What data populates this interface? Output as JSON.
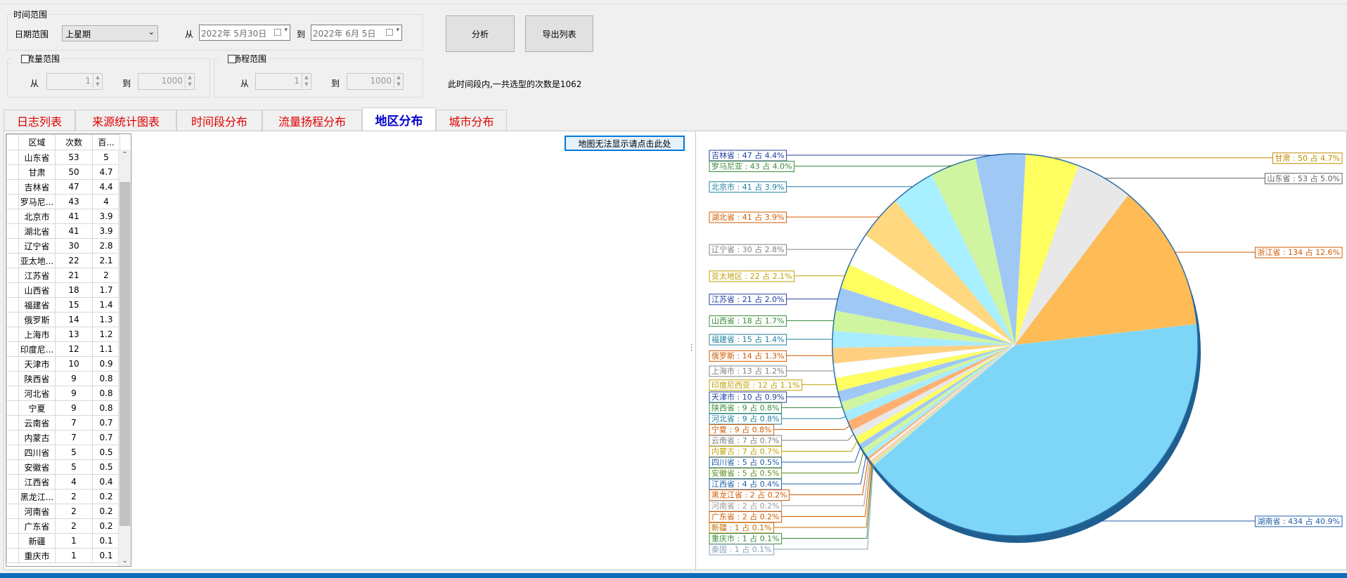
{
  "time_range": {
    "legend": "时间范围",
    "date_range_label": "日期范围",
    "date_range_value": "上星期",
    "from_label": "从",
    "to_label": "到",
    "from_date": "2022年  5月30日",
    "to_date": "2022年  6月  5日"
  },
  "buttons": {
    "analyze": "分析",
    "export": "导出列表",
    "map": "地图无法显示请点击此处"
  },
  "flow_range": {
    "legend": "流量范围",
    "from_label": "从",
    "to_label": "到",
    "from_value": "1",
    "to_value": "1000"
  },
  "head_range": {
    "legend": "扬程范围",
    "from_label": "从",
    "to_label": "到",
    "from_value": "1",
    "to_value": "1000"
  },
  "summary": "此时间段内,一共选型的次数是1062",
  "tabs": [
    {
      "label": "日志列表"
    },
    {
      "label": "来源统计图表"
    },
    {
      "label": "时间段分布"
    },
    {
      "label": "流量扬程分布"
    },
    {
      "label": "地区分布"
    },
    {
      "label": "城市分布"
    }
  ],
  "active_tab": 4,
  "grid": {
    "headers": [
      "区域",
      "次数",
      "百..."
    ],
    "rows": [
      [
        "山东省",
        "53",
        "5"
      ],
      [
        "甘肃",
        "50",
        "4.7"
      ],
      [
        "吉林省",
        "47",
        "4.4"
      ],
      [
        "罗马尼...",
        "43",
        "4"
      ],
      [
        "北京市",
        "41",
        "3.9"
      ],
      [
        "湖北省",
        "41",
        "3.9"
      ],
      [
        "辽宁省",
        "30",
        "2.8"
      ],
      [
        "亚太地...",
        "22",
        "2.1"
      ],
      [
        "江苏省",
        "21",
        "2"
      ],
      [
        "山西省",
        "18",
        "1.7"
      ],
      [
        "福建省",
        "15",
        "1.4"
      ],
      [
        "俄罗斯",
        "14",
        "1.3"
      ],
      [
        "上海市",
        "13",
        "1.2"
      ],
      [
        "印度尼...",
        "12",
        "1.1"
      ],
      [
        "天津市",
        "10",
        "0.9"
      ],
      [
        "陕西省",
        "9",
        "0.8"
      ],
      [
        "河北省",
        "9",
        "0.8"
      ],
      [
        "宁夏",
        "9",
        "0.8"
      ],
      [
        "云南省",
        "7",
        "0.7"
      ],
      [
        "内蒙古",
        "7",
        "0.7"
      ],
      [
        "四川省",
        "5",
        "0.5"
      ],
      [
        "安徽省",
        "5",
        "0.5"
      ],
      [
        "江西省",
        "4",
        "0.4"
      ],
      [
        "黑龙江...",
        "2",
        "0.2"
      ],
      [
        "河南省",
        "2",
        "0.2"
      ],
      [
        "广东省",
        "2",
        "0.2"
      ],
      [
        "新疆",
        "1",
        "0.1"
      ],
      [
        "重庆市",
        "1",
        "0.1"
      ]
    ]
  },
  "chart_data": {
    "type": "pie",
    "total": 1062,
    "slices": [
      {
        "name": "湖南省",
        "value": 434,
        "pct": "40.9%",
        "color": "#7dd6f7",
        "label": "湖南省 : 434 占 40.9%",
        "lc": "#1f5fa8"
      },
      {
        "name": "泰国",
        "value": 1,
        "pct": "0.1%",
        "color": "#e8f0c8",
        "label": "泰国 : 1 占 0.1%",
        "lc": "#8aa0b8"
      },
      {
        "name": "重庆市",
        "value": 1,
        "pct": "0.1%",
        "color": "#bfe6a0",
        "label": "重庆市 : 1 占 0.1%",
        "lc": "#3a8a3a"
      },
      {
        "name": "新疆",
        "value": 1,
        "pct": "0.1%",
        "color": "#ffe0b0",
        "label": "新疆 : 1 占 0.1%",
        "lc": "#c07000"
      },
      {
        "name": "广东省",
        "value": 2,
        "pct": "0.2%",
        "color": "#ffd0a0",
        "label": "广东省 : 2 占 0.2%",
        "lc": "#d05a00"
      },
      {
        "name": "河南省",
        "value": 2,
        "pct": "0.2%",
        "color": "#f8f8f8",
        "label": "河南省 : 2 占 0.2%",
        "lc": "#9a9a9a"
      },
      {
        "name": "黑龙江省",
        "value": 2,
        "pct": "0.2%",
        "color": "#ffb070",
        "label": "黑龙江省 : 2 占 0.2%",
        "lc": "#d05a00"
      },
      {
        "name": "江西省",
        "value": 4,
        "pct": "0.4%",
        "color": "#a8ecff",
        "label": "江西省 : 4 占 0.4%",
        "lc": "#1f5fa8"
      },
      {
        "name": "安徽省",
        "value": 5,
        "pct": "0.5%",
        "color": "#d0f5a0",
        "label": "安徽省 : 5 占 0.5%",
        "lc": "#5a8a1a"
      },
      {
        "name": "四川省",
        "value": 5,
        "pct": "0.5%",
        "color": "#a0c8f5",
        "label": "四川省 : 5 占 0.5%",
        "lc": "#1f5fa8"
      },
      {
        "name": "内蒙古",
        "value": 7,
        "pct": "0.7%",
        "color": "#ffff60",
        "label": "内蒙古 : 7 占 0.7%",
        "lc": "#c0a000"
      },
      {
        "name": "云南省",
        "value": 7,
        "pct": "0.7%",
        "color": "#e8e8e8",
        "label": "云南省 : 7 占 0.7%",
        "lc": "#808080"
      },
      {
        "name": "宁夏",
        "value": 9,
        "pct": "0.8%",
        "color": "#ffb070",
        "label": "宁夏 : 9 占 0.8%",
        "lc": "#d05a00"
      },
      {
        "name": "河北省",
        "value": 9,
        "pct": "0.8%",
        "color": "#a8ecff",
        "label": "河北省 : 9 占 0.8%",
        "lc": "#1f7f9f"
      },
      {
        "name": "陕西省",
        "value": 9,
        "pct": "0.8%",
        "color": "#d0f5a0",
        "label": "陕西省 : 9 占 0.8%",
        "lc": "#3a8a3a"
      },
      {
        "name": "天津市",
        "value": 10,
        "pct": "0.9%",
        "color": "#a0c8f5",
        "label": "天津市 : 10 占 0.9%",
        "lc": "#1f3f9f"
      },
      {
        "name": "印度尼西亚",
        "value": 12,
        "pct": "1.1%",
        "color": "#ffff60",
        "label": "印度尼西亚 : 12 占 1.1%",
        "lc": "#c0a000"
      },
      {
        "name": "上海市",
        "value": 13,
        "pct": "1.2%",
        "color": "#ffffff",
        "label": "上海市 : 13 占 1.2%",
        "lc": "#808080"
      },
      {
        "name": "俄罗斯",
        "value": 14,
        "pct": "1.3%",
        "color": "#ffd080",
        "label": "俄罗斯 : 14 占 1.3%",
        "lc": "#d05a00"
      },
      {
        "name": "福建省",
        "value": 15,
        "pct": "1.4%",
        "color": "#a8ecff",
        "label": "福建省 : 15 占 1.4%",
        "lc": "#1f7f9f"
      },
      {
        "name": "山西省",
        "value": 18,
        "pct": "1.7%",
        "color": "#d0f5a0",
        "label": "山西省 : 18 占 1.7%",
        "lc": "#3a8a3a"
      },
      {
        "name": "江苏省",
        "value": 21,
        "pct": "2.0%",
        "color": "#a0c8f5",
        "label": "江苏省 : 21 占 2.0%",
        "lc": "#1f3f9f"
      },
      {
        "name": "亚太地区",
        "value": 22,
        "pct": "2.1%",
        "color": "#ffff60",
        "label": "亚太地区 : 22 占 2.1%",
        "lc": "#c0a000"
      },
      {
        "name": "辽宁省",
        "value": 30,
        "pct": "2.8%",
        "color": "#ffffff",
        "label": "辽宁省 : 30 占 2.8%",
        "lc": "#808080"
      },
      {
        "name": "湖北省",
        "value": 41,
        "pct": "3.9%",
        "color": "#ffd880",
        "label": "湖北省 : 41 占 3.9%",
        "lc": "#d05a00"
      },
      {
        "name": "北京市",
        "value": 41,
        "pct": "3.9%",
        "color": "#a8f0ff",
        "label": "北京市 : 41 占 3.9%",
        "lc": "#1f7f9f"
      },
      {
        "name": "罗马尼亚",
        "value": 43,
        "pct": "4.0%",
        "color": "#d0f5a0",
        "label": "罗马尼亚 : 43 占 4.0%",
        "lc": "#3a8a3a"
      },
      {
        "name": "吉林省",
        "value": 47,
        "pct": "4.4%",
        "color": "#a0c8f5",
        "label": "吉林省 : 47 占 4.4%",
        "lc": "#1f3f9f"
      },
      {
        "name": "甘肃",
        "value": 50,
        "pct": "4.7%",
        "color": "#ffff60",
        "label": "甘肃 : 50 占 4.7%",
        "lc": "#c08a00"
      },
      {
        "name": "山东省",
        "value": 53,
        "pct": "5.0%",
        "color": "#e8e8e8",
        "label": "山东省 : 53 占 5.0%",
        "lc": "#606060"
      },
      {
        "name": "浙江省",
        "value": 134,
        "pct": "12.6%",
        "color": "#ffbb55",
        "label": "浙江省 : 134 占 12.6%",
        "lc": "#d05a00"
      }
    ]
  }
}
